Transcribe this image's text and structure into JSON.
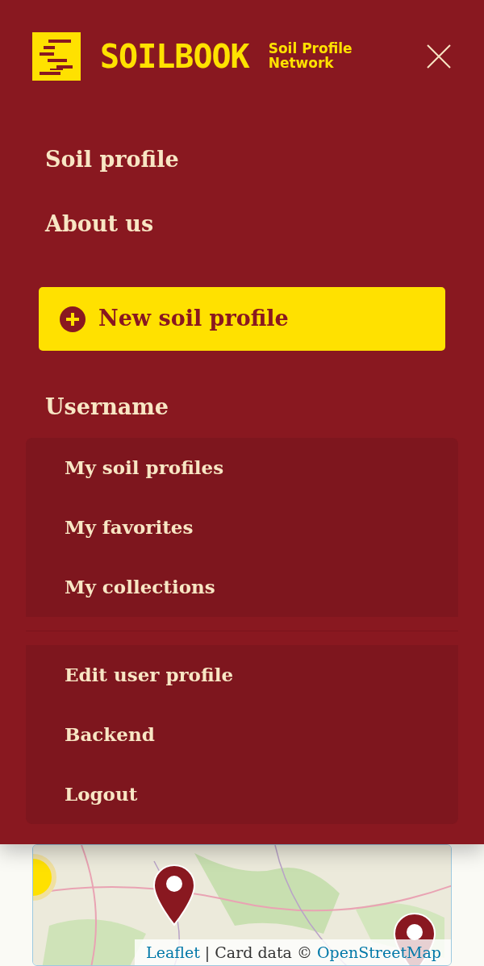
{
  "brand": {
    "name": "SOILBOOK",
    "tagline_lines": [
      "Soil Profile",
      "Network"
    ]
  },
  "nav": [
    {
      "label": "Soil profile"
    },
    {
      "label": "About us"
    }
  ],
  "cta": {
    "label": "New soil profile"
  },
  "user": {
    "name": "Username",
    "groups": [
      [
        "My soil profiles",
        "My favorites",
        "My collections"
      ],
      [
        "Edit user profile",
        "Backend",
        "Logout"
      ]
    ]
  },
  "map": {
    "kind": "picture",
    "attribution": [
      {
        "text": "Leaflet",
        "link": true
      },
      {
        "text": "| Card data ©",
        "link": false
      },
      {
        "text": "OpenStreetMap",
        "link": true
      }
    ]
  }
}
